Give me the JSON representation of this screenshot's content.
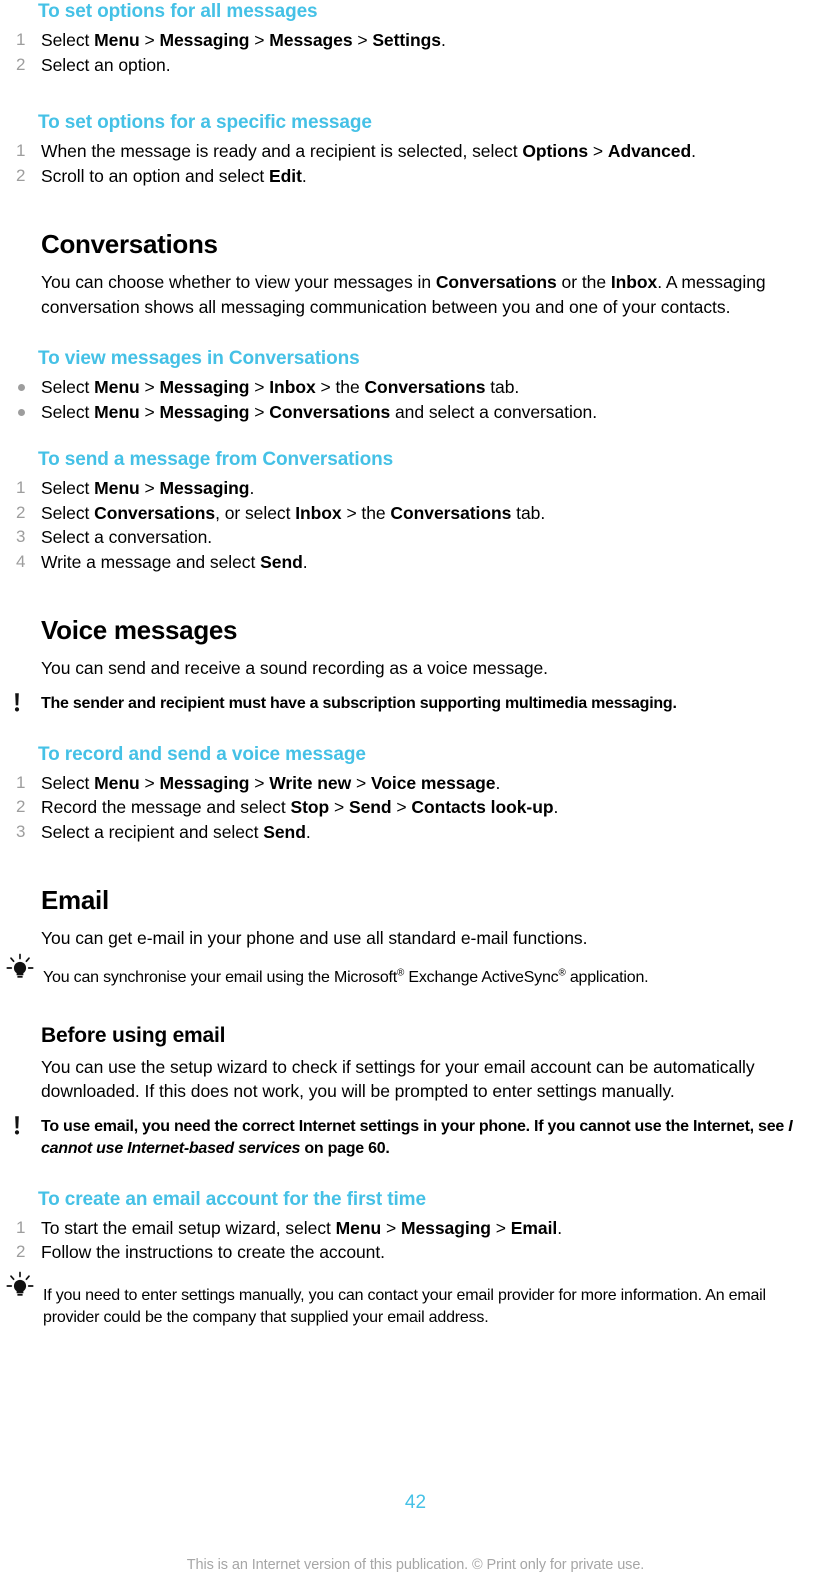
{
  "colors": {
    "heading_accent": "#45c1e6",
    "body_text": "#000000",
    "marker_gray": "#9d9d9d",
    "footer_gray": "#a6a6a6"
  },
  "sections": {
    "set_options_all": {
      "heading": "To set options for all messages",
      "steps": [
        {
          "num": "1",
          "parts": [
            "Select ",
            "Menu",
            " > ",
            "Messaging",
            " > ",
            "Messages",
            " > ",
            "Settings",
            "."
          ]
        },
        {
          "num": "2",
          "parts": [
            "Select an option."
          ]
        }
      ]
    },
    "set_options_specific": {
      "heading": "To set options for a specific message",
      "steps": [
        {
          "num": "1",
          "text": "When the message is ready and a recipient is selected, select Options > Advanced."
        },
        {
          "num": "2",
          "text": "Scroll to an option and select Edit."
        }
      ]
    },
    "conversations": {
      "heading": "Conversations",
      "intro": "You can choose whether to view your messages in Conversations or the Inbox. A messaging conversation shows all messaging communication between you and one of your contacts.",
      "view_messages": {
        "heading": "To view messages in Conversations",
        "bullets": [
          "Select Menu > Messaging > Inbox > the Conversations tab.",
          "Select Menu > Messaging > Conversations and select a conversation."
        ]
      },
      "send_message": {
        "heading": "To send a message from Conversations",
        "steps": [
          {
            "num": "1",
            "text": "Select Menu > Messaging."
          },
          {
            "num": "2",
            "text": "Select Conversations, or select Inbox > the Conversations tab."
          },
          {
            "num": "3",
            "text": "Select a conversation."
          },
          {
            "num": "4",
            "text": "Write a message and select Send."
          }
        ]
      }
    },
    "voice_messages": {
      "heading": "Voice messages",
      "intro": "You can send and receive a sound recording as a voice message.",
      "note": "The sender and recipient must have a subscription supporting multimedia messaging.",
      "note_icon": "warning-exclamation-icon",
      "record_send": {
        "heading": "To record and send a voice message",
        "steps": [
          {
            "num": "1",
            "text": "Select Menu > Messaging > Write new > Voice message."
          },
          {
            "num": "2",
            "text": "Record the message and select Stop > Send > Contacts look-up."
          },
          {
            "num": "3",
            "text": "Select a recipient and select Send."
          }
        ]
      }
    },
    "email": {
      "heading": "Email",
      "intro": "You can get e-mail in your phone and use all standard e-mail functions.",
      "tip_icon": "lightbulb-tip-icon",
      "tip_prefix": "You can synchronise your email using the Microsoft",
      "tip_mid": " Exchange ActiveSync",
      "tip_suffix": " application.",
      "registered_mark": "®",
      "before_using": {
        "heading": "Before using email",
        "intro": "You can use the setup wizard to check if settings for your email account can be automatically downloaded. If this does not work, you will be prompted to enter settings manually.",
        "note_icon": "warning-exclamation-icon",
        "note_prefix": "To use email, you need the correct Internet settings in your phone. If you cannot use the Internet, see ",
        "note_italic": "I cannot use Internet-based services",
        "note_suffix": " on page 60."
      },
      "create_account": {
        "heading": "To create an email account for the first time",
        "steps": [
          {
            "num": "1",
            "text": "To start the email setup wizard, select Menu > Messaging > Email."
          },
          {
            "num": "2",
            "text": "Follow the instructions to create the account."
          }
        ],
        "tip_icon": "lightbulb-tip-icon",
        "tip": "If you need to enter settings manually, you can contact your email provider for more information. An email provider could be the company that supplied your email address."
      }
    }
  },
  "footer": {
    "page_number": "42",
    "notice": "This is an Internet version of this publication. © Print only for private use."
  }
}
